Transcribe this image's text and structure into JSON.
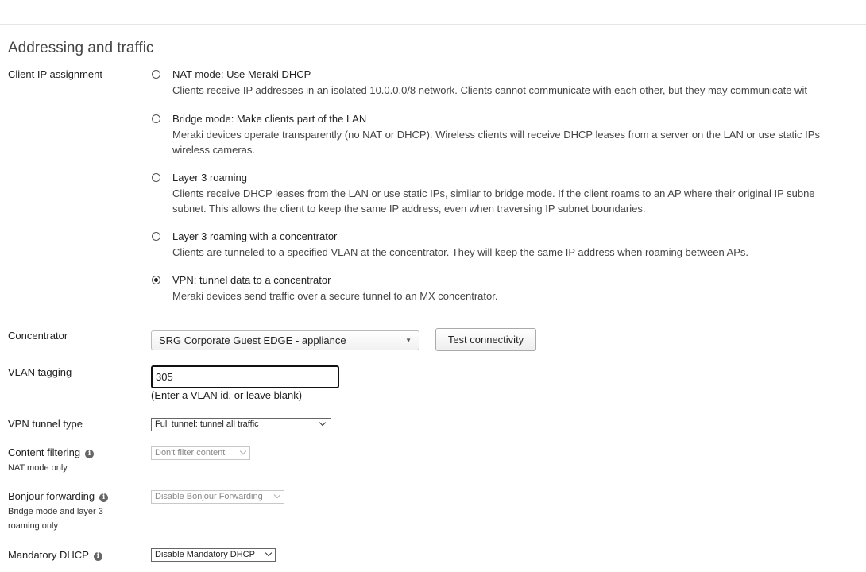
{
  "section": {
    "title": "Addressing and traffic"
  },
  "client_ip": {
    "label": "Client IP assignment",
    "options": [
      {
        "title": "NAT mode: Use Meraki DHCP",
        "desc1": "Clients receive IP addresses in an isolated 10.0.0.0/8 network. Clients cannot communicate with each other, but they may communicate wit",
        "desc2": "",
        "selected": false
      },
      {
        "title": "Bridge mode: Make clients part of the LAN",
        "desc1": "Meraki devices operate transparently (no NAT or DHCP). Wireless clients will receive DHCP leases from a server on the LAN or use static IPs",
        "desc2": "wireless cameras.",
        "selected": false
      },
      {
        "title": "Layer 3 roaming",
        "desc1": "Clients receive DHCP leases from the LAN or use static IPs, similar to bridge mode. If the client roams to an AP where their original IP subne",
        "desc2": "subnet. This allows the client to keep the same IP address, even when traversing IP subnet boundaries.",
        "selected": false
      },
      {
        "title": "Layer 3 roaming with a concentrator",
        "desc1": "Clients are tunneled to a specified VLAN at the concentrator. They will keep the same IP address when roaming between APs.",
        "desc2": "",
        "selected": false
      },
      {
        "title": "VPN: tunnel data to a concentrator",
        "desc1": "Meraki devices send traffic over a secure tunnel to an MX concentrator.",
        "desc2": "",
        "selected": true
      }
    ]
  },
  "concentrator": {
    "label": "Concentrator",
    "selected": "SRG Corporate Guest EDGE - appliance",
    "button": "Test connectivity"
  },
  "vlan_tagging": {
    "label": "VLAN tagging",
    "value": "305",
    "hint": "(Enter a VLAN id, or leave blank)"
  },
  "vpn_tunnel": {
    "label": "VPN tunnel type",
    "selected": "Full tunnel: tunnel all traffic"
  },
  "content_filtering": {
    "label": "Content filtering",
    "sublabel": "NAT mode only",
    "selected": "Don't filter content"
  },
  "bonjour": {
    "label": "Bonjour forwarding",
    "sublabel": "Bridge mode and layer 3 roaming only",
    "selected": "Disable Bonjour Forwarding"
  },
  "mandatory_dhcp": {
    "label": "Mandatory DHCP",
    "selected": "Disable Mandatory DHCP"
  }
}
